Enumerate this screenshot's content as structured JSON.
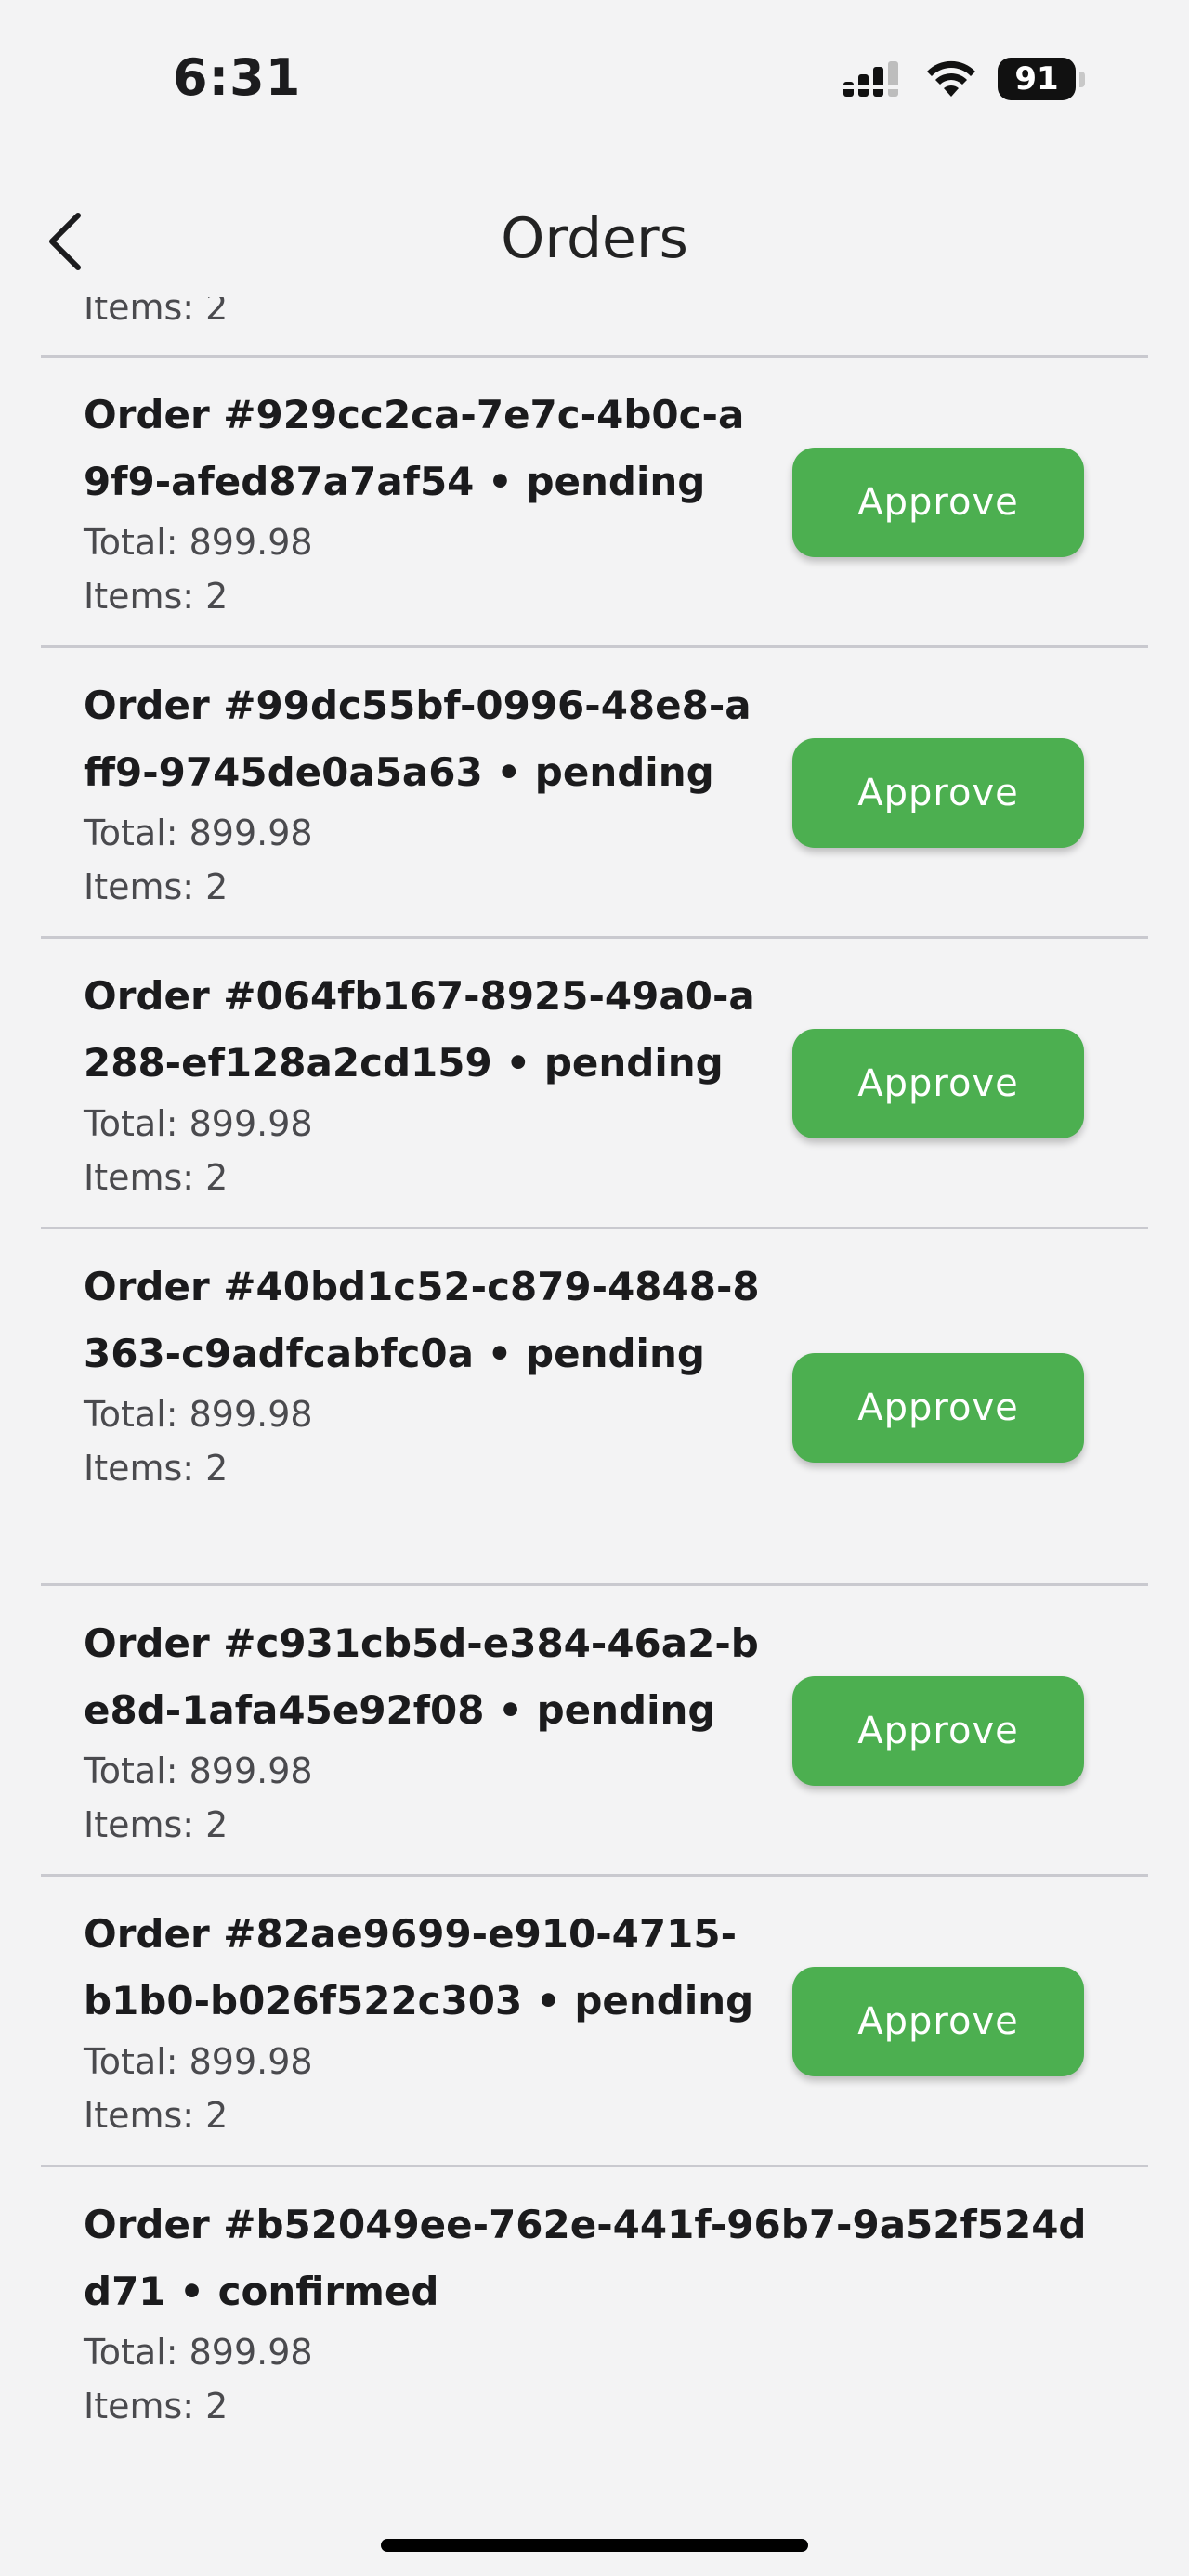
{
  "status_bar": {
    "time": "6:31",
    "battery": "91",
    "icons": [
      "cellular-signal-icon",
      "wifi-icon",
      "battery-icon"
    ]
  },
  "nav": {
    "title": "Orders",
    "back_icon": "chevron-left-icon"
  },
  "partial_item": {
    "items_text": "Items: 2"
  },
  "orders": [
    {
      "title": "Order #929cc2ca-7e7c-4b0c-a9f9-afed87a7af54 • pending",
      "total": "Total: 899.98",
      "items": "Items: 2",
      "action": "Approve"
    },
    {
      "title": "Order #99dc55bf-0996-48e8-aff9-9745de0a5a63 • pending",
      "total": "Total: 899.98",
      "items": "Items: 2",
      "action": "Approve"
    },
    {
      "title": "Order #064fb167-8925-49a0-a288-ef128a2cd159 • pending",
      "total": "Total: 899.98",
      "items": "Items: 2",
      "action": "Approve"
    },
    {
      "title": "Order #40bd1c52-c879-4848-8363-c9adfcabfc0a • pending",
      "total": "Total: 899.98",
      "items": "Items: 2",
      "action": "Approve"
    },
    {
      "title": "Order #c931cb5d-e384-46a2-be8d-1afa45e92f08 • pending",
      "total": "Total: 899.98",
      "items": "Items: 2",
      "action": "Approve"
    },
    {
      "title": "Order #82ae9699-e910-4715-b1b0-b026f522c303 • pending",
      "total": "Total: 899.98",
      "items": "Items: 2",
      "action": "Approve"
    },
    {
      "title": "Order #b52049ee-762e-441f-96b7-9a52f524dd71 • confirmed",
      "total": "Total: 899.98",
      "items": "Items: 2"
    }
  ],
  "colors": {
    "background": "#f3f3f4",
    "approve_button": "#4caf50",
    "divider": "#c9c9cf"
  }
}
